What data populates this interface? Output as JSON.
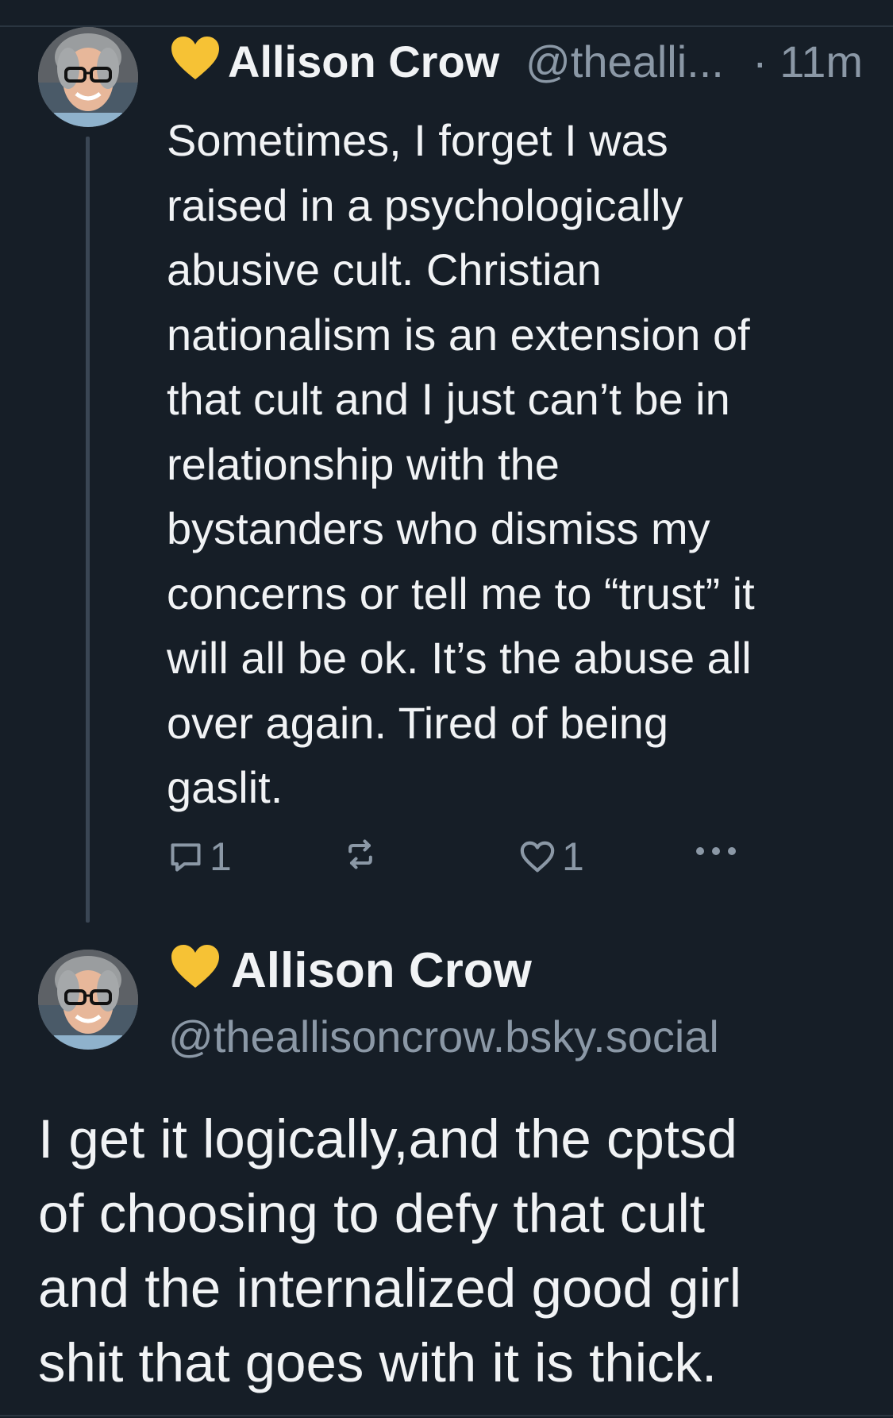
{
  "colors": {
    "background": "#161e27",
    "text": "#f1f3f5",
    "muted": "#8b98a6",
    "thread_line": "#3a4654",
    "heart_badge": "#f6c235"
  },
  "post1": {
    "badge_icon": "yellow-heart-icon",
    "display_name": "Allison Crow",
    "handle_truncated": "@thealli...",
    "time": "· 11m",
    "text": "Sometimes, I forget I was\nraised in a psychologically\nabusive cult.  Christian\nnationalism is an extension of\nthat cult and I just can’t be in\nrelationship with the\nbystanders who dismiss my\nconcerns or tell me to “trust” it\nwill all be ok. It’s the abuse all\nover again. Tired of being\ngaslit.",
    "actions": {
      "reply_icon": "reply-icon",
      "reply_count": "1",
      "repost_icon": "repost-icon",
      "like_icon": "heart-outline-icon",
      "like_count": "1",
      "more_icon": "more-dots-icon"
    }
  },
  "post2": {
    "badge_icon": "yellow-heart-icon",
    "display_name": "Allison Crow",
    "handle": "@theallisoncrow.bsky.social",
    "text": "I get it logically,and the cptsd\nof choosing to defy that cult\nand the internalized good girl\nshit that goes with it is thick."
  }
}
